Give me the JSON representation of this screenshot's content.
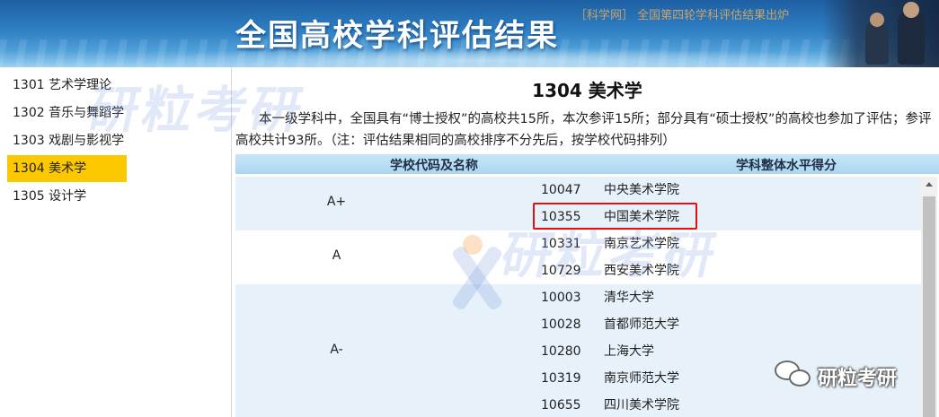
{
  "banner": {
    "title": "全国高校学科评估结果",
    "subtitle": "［科学网］ 全国第四轮学科评估结果出炉"
  },
  "sidebar": {
    "items": [
      {
        "label": "1301 艺术学理论",
        "active": false
      },
      {
        "label": "1302 音乐与舞蹈学",
        "active": false
      },
      {
        "label": "1303 戏剧与影视学",
        "active": false
      },
      {
        "label": "1304 美术学",
        "active": true
      },
      {
        "label": "1305 设计学",
        "active": false
      }
    ]
  },
  "main": {
    "title": "1304 美术学",
    "description": "本一级学科中，全国具有“博士授权”的高校共15所，本次参评15所；部分具有“硕士授权”的高校也参加了评估；参评高校共计93所。（注：评估结果相同的高校排序不分先后，按学校代码排列）",
    "table": {
      "headers": [
        "学校代码及名称",
        "学科整体水平得分"
      ],
      "grades": [
        {
          "grade": "A+",
          "schools": [
            {
              "code": "10047",
              "name": "中央美术学院"
            },
            {
              "code": "10355",
              "name": "中国美术学院"
            }
          ]
        },
        {
          "grade": "A",
          "schools": [
            {
              "code": "10331",
              "name": "南京艺术学院"
            },
            {
              "code": "10729",
              "name": "西安美术学院"
            }
          ]
        },
        {
          "grade": "A-",
          "schools": [
            {
              "code": "10003",
              "name": "清华大学"
            },
            {
              "code": "10028",
              "name": "首都师范大学"
            },
            {
              "code": "10280",
              "name": "上海大学"
            },
            {
              "code": "10319",
              "name": "南京师范大学"
            },
            {
              "code": "10655",
              "name": "四川美术学院"
            }
          ]
        }
      ]
    }
  },
  "watermark": {
    "text": "研粒考研"
  },
  "wechat": {
    "label": "研粒考研",
    "icon": "wechat-icon"
  },
  "colors": {
    "active_nav": "#fcc800",
    "highlight_border": "#e01010",
    "table_header": "#a9d6f3",
    "band_blue": "#e6f1fa"
  }
}
